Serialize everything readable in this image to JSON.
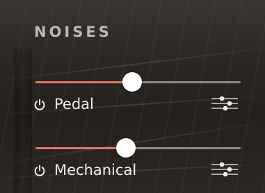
{
  "panel": {
    "title": "NOISES"
  },
  "noises": [
    {
      "label": "Pedal",
      "level": 0.47
    },
    {
      "label": "Mechanical",
      "level": 0.44
    }
  ],
  "icons": {
    "power": "power-icon",
    "settings": "sliders-icon"
  },
  "colors": {
    "accent": "#e9766a",
    "track": "#8f8b87",
    "thumb": "#ffffff",
    "title": "#bdb8b3",
    "label": "#f2f0ee"
  }
}
